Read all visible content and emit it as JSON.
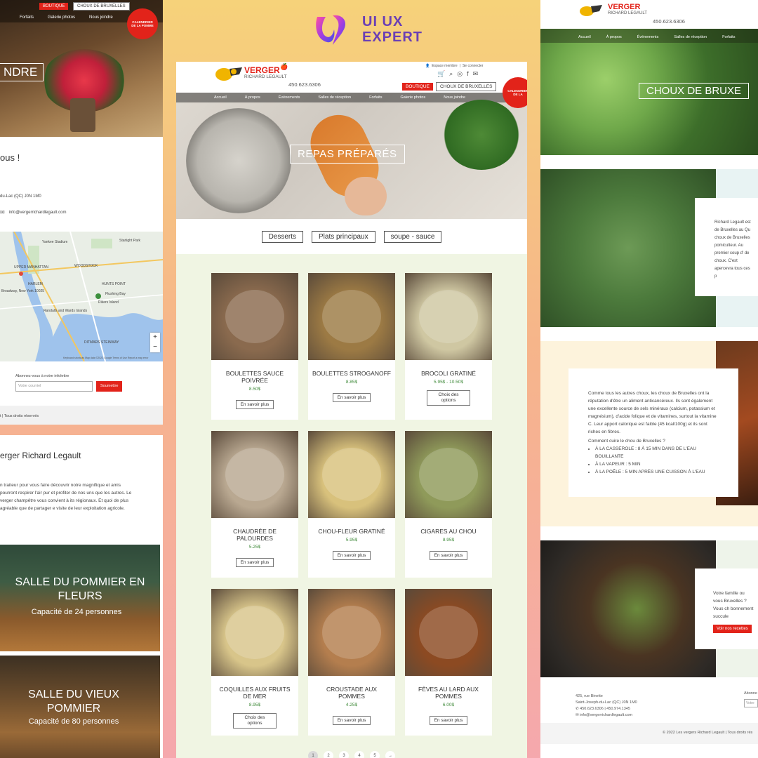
{
  "brand": {
    "name": "UI UX EXPERT",
    "line1": "UI UX",
    "line2": "EXPERT"
  },
  "site": {
    "logo_main": "VERGER",
    "logo_sub": "RICHARD LEGAULT",
    "phone": "450.623.6306",
    "member": "Espace membre",
    "login": "Se connecter",
    "boutique": "BOUTIQUE",
    "choux_btn": "CHOUX DE BRUXELLES",
    "calendar": "CALENDRIER DE LA POMME",
    "calendar_short": "CALENDRIER DE LA",
    "menu": [
      "Accueil",
      "À propos",
      "Événements",
      "Salles de réception",
      "Forfaits",
      "Galerie photos",
      "Nous joindre"
    ]
  },
  "left_top": {
    "menu": [
      "Forfaits",
      "Galerie photos",
      "Nous joindre"
    ],
    "hero_title": "NDRE",
    "heading": "ous !",
    "address": "du-Lac (QC) J0N 1M0",
    "email": "info@vergerrichardlegault.com",
    "newsletter_label": "Abonnez-vous à notre infolettre",
    "newsletter_placeholder": "Votre courriel",
    "newsletter_submit": "Soumettre",
    "copyright": "t | Tous droits réservés",
    "map_labels": [
      "Yankee Stadium",
      "Starlight Park",
      "UPPER MANHATTAN",
      "WOODSTOCK",
      "HARLEM",
      "HUNTS POINT",
      "Rikers Island",
      "Flushing Bay",
      "DITMARS STEINWAY",
      "Randalls and Wards Islands",
      "Broadway, New York 10025"
    ],
    "map_footer": "Keyboard shortcuts   Map data ©2022 Google   Terms of Use   Report a map error"
  },
  "left_bottom": {
    "title": "erger Richard Legault",
    "paragraph": "n traiteur pour vous faire découvrir notre magnifique et amis pourront respirer l'air pur et profiter de nos uns que les autres. Le verger champêtre vous convient à its régionaux. Et quoi de plus agréable que de partager e visite de leur exploitation agricole.",
    "room1_title": "SALLE DU POMMIER EN FLEURS",
    "room1_capacity": "Capacité de 24 personnes",
    "room2_title": "SALLE DU VIEUX POMMIER",
    "room2_capacity": "Capacité de 80 personnes"
  },
  "center": {
    "hero_title": "REPAS PRÉPARÉS",
    "filters": [
      "Desserts",
      "Plats principaux",
      "soupe - sauce"
    ],
    "more_label": "En savoir plus",
    "options_label": "Choix des options",
    "products": [
      {
        "name": "BOULETTES SAUCE POIVRÉE",
        "price": "8.50$",
        "action": "more",
        "bg": "#8a6a4e"
      },
      {
        "name": "BOULETTES STROGANOFF",
        "price": "8.85$",
        "action": "more",
        "bg": "#9c7a44"
      },
      {
        "name": "BROCOLI GRATINÉ",
        "price": "5.95$ - 10.50$",
        "action": "options",
        "bg": "#cfc7a2"
      },
      {
        "name": "CHAUDRÉE DE PALOURDES",
        "price": "5.25$",
        "action": "more",
        "bg": "#b9a891"
      },
      {
        "name": "CHOU-FLEUR GRATINÉ",
        "price": "5.95$",
        "action": "more",
        "bg": "#d8c17c"
      },
      {
        "name": "CIGARES AU CHOU",
        "price": "8.95$",
        "action": "more",
        "bg": "#8f9a5a"
      },
      {
        "name": "COQUILLES AUX FRUITS DE MER",
        "price": "8.95$",
        "action": "options",
        "bg": "#d8c58a"
      },
      {
        "name": "CROUSTADE AUX POMMES",
        "price": "4.25$",
        "action": "more",
        "bg": "#b47e4e"
      },
      {
        "name": "FÈVES AU LARD AUX POMMES",
        "price": "6.00$",
        "action": "more",
        "bg": "#8c4a22"
      }
    ],
    "pages": [
      "1",
      "2",
      "3",
      "4",
      "5",
      "→"
    ]
  },
  "right": {
    "hero_title": "CHOUX DE BRUXE",
    "intro": "Richard Legault est de Bruxelles au Qu choux de Bruxelles pomiculteur. Au premier coup d' de choux. C'est apercevra tous ces p",
    "info": "Comme tous les autres choux, les choux de Bruxelles ont la réputation d'être un aliment anticancéreux. Ils sont également une excellente source de sels minéraux (calcium, potassium et magnésium), d'acide folique et de vitamines, surtout la vitamine C. Leur apport calorique est faible (45 kcal/100g) et ils sont riches en fibres.",
    "how_title": "Comment cuire le chou de Bruxelles ?",
    "how_items": [
      "À LA CASSEROLE : 8 À 15 MIN DANS DE L'EAU BOUILLANTE",
      "À LA VAPEUR : 5 MIN",
      "À LA POÊLE : 5 MIN APRÈS UNE CUISSON À L'EAU"
    ],
    "recipe_text": "Votre famille ou vous Bruxelles ? Vous ch bonnement succule",
    "recipe_btn": "Voir nos recettes",
    "footer_address": "425, rue Binette",
    "footer_city": "Saint-Joseph-du-Lac (QC) J0N 1M0",
    "footer_phone": "450.623.6306 | 450.974.1345",
    "footer_email": "info@vergerrichardlegault.com",
    "footer_news": "Abonne",
    "footer_input": "Votre",
    "copyright": "© 2022 Les vergers Richard Legault | Tous droits rés"
  },
  "colors": {
    "red": "#e2231a",
    "green_price": "#3f8a3a",
    "bg_center": "#f0f5e3"
  }
}
